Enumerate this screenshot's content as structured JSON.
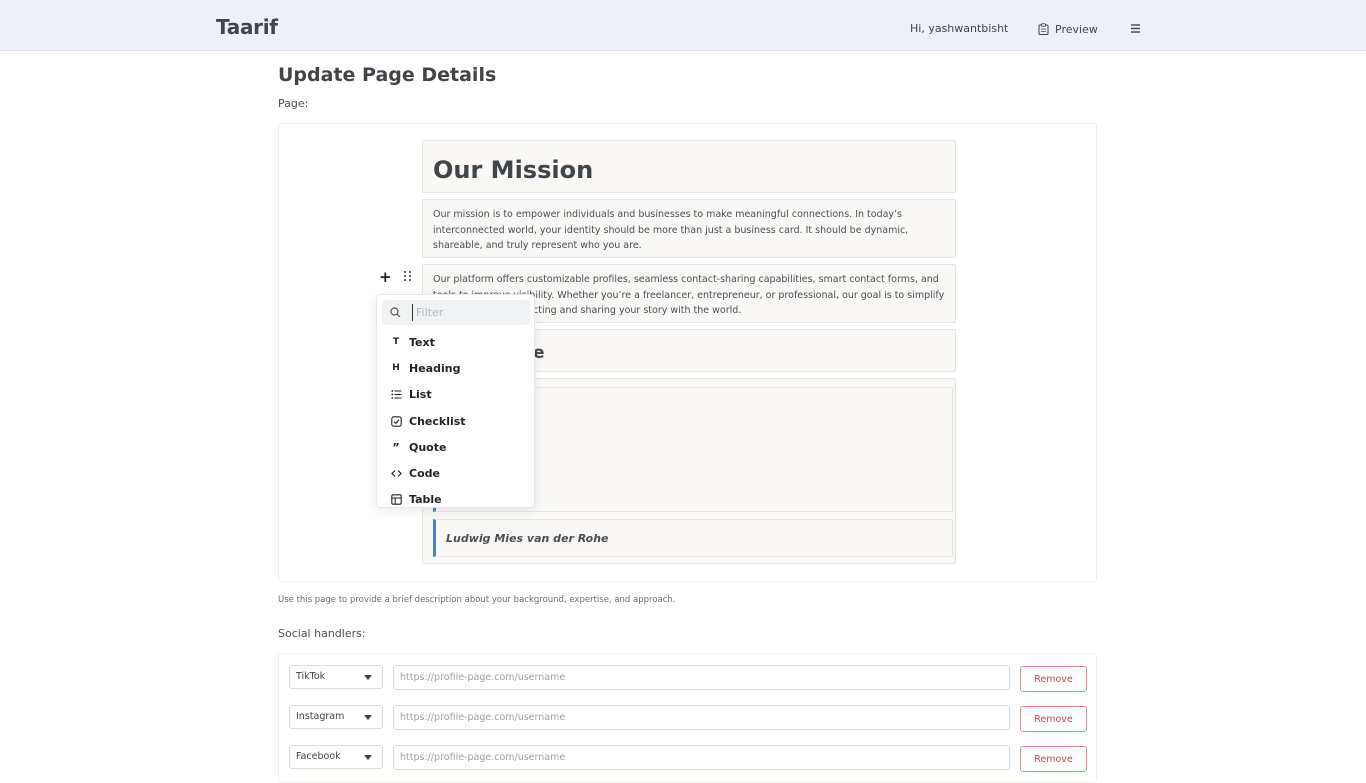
{
  "header": {
    "brand": "Taarif",
    "greeting": "Hi, yashwantbisht",
    "preview_label": "Preview"
  },
  "page": {
    "title": "Update Page Details",
    "page_label": "Page:",
    "help_text": "Use this page to provide a brief description about your background, expertise, and approach."
  },
  "editor": {
    "heading": "Our Mission",
    "paragraph1": "Our mission is to empower individuals and businesses to make meaningful connections. In today’s interconnected world, your identity should be more than just a business card. It should be dynamic, shareable, and truly represent who you are.",
    "paragraph2_line1": "Our platform offers customizable profiles, seamless contact-sharing capabilities, smart contact forms, and",
    "paragraph2_line2": "tools to improve visibility. Whether you’re a freelancer, entrepreneur, or professional, our goal is to simplify",
    "paragraph2_line3": "cting and sharing your story with the world.",
    "heading2_partial": "e",
    "quote_caption": "Ludwig Mies van der Rohe"
  },
  "block_menu": {
    "filter_placeholder": "Filter",
    "items": [
      {
        "label": "Text",
        "icon": "text-icon"
      },
      {
        "label": "Heading",
        "icon": "heading-icon"
      },
      {
        "label": "List",
        "icon": "list-icon"
      },
      {
        "label": "Checklist",
        "icon": "checklist-icon"
      },
      {
        "label": "Quote",
        "icon": "quote-icon"
      },
      {
        "label": "Code",
        "icon": "code-icon"
      },
      {
        "label": "Table",
        "icon": "table-icon"
      }
    ]
  },
  "social": {
    "label": "Social handlers:",
    "url_placeholder": "https://profile-page.com/username",
    "remove_label": "Remove",
    "rows": [
      {
        "platform": "TikTok"
      },
      {
        "platform": "Instagram"
      },
      {
        "platform": "Facebook"
      }
    ]
  },
  "colors": {
    "quote_accent": "#4a7fd4",
    "remove_border": "#e28b8b",
    "remove_text": "#c64a4a"
  }
}
